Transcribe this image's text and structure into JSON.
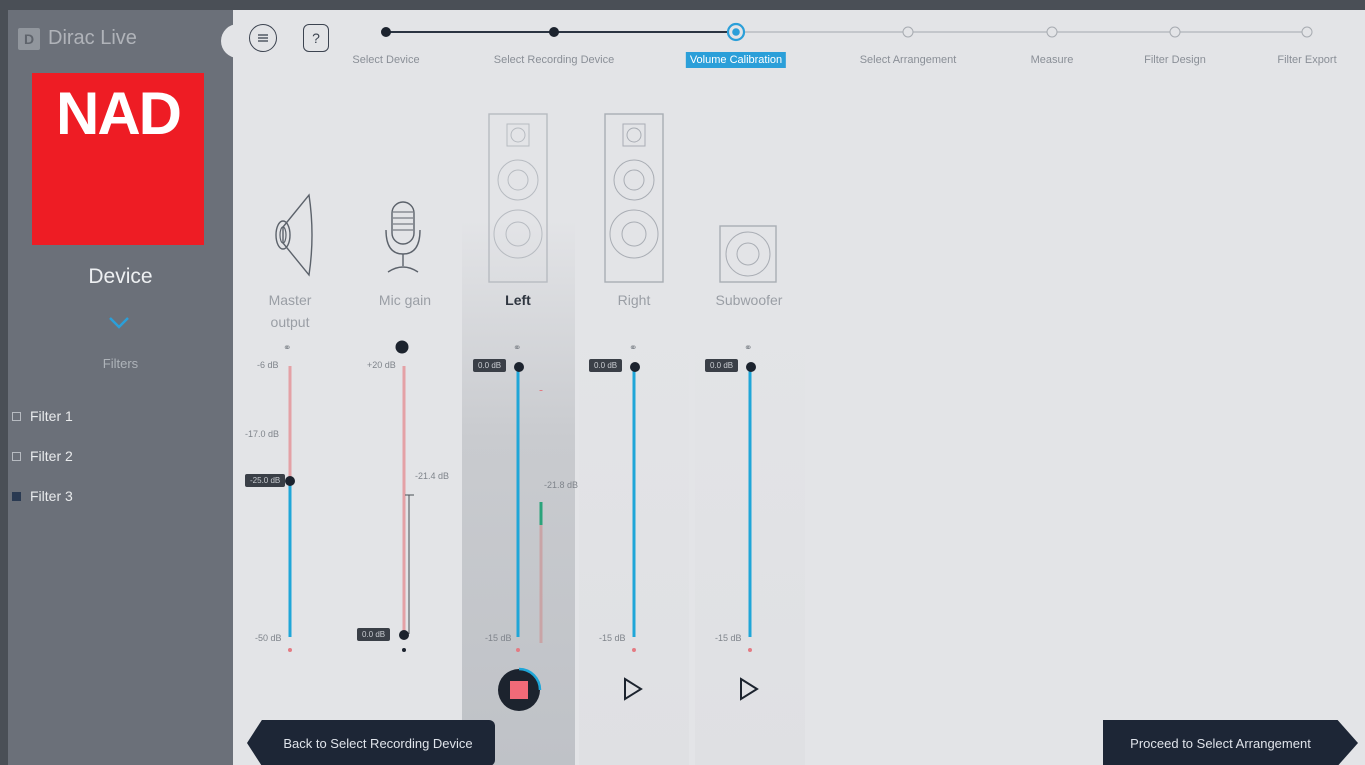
{
  "app": {
    "brand": "Dirac Live"
  },
  "sidebar": {
    "device_logo_text": "NAD",
    "device_label": "Device",
    "filters_heading": "Filters",
    "filters": [
      {
        "label": "Filter 1",
        "selected": false
      },
      {
        "label": "Filter 2",
        "selected": false
      },
      {
        "label": "Filter 3",
        "selected": true
      }
    ]
  },
  "toolbar": {
    "help_label": "?"
  },
  "steps": [
    {
      "label": "Select Device",
      "state": "done"
    },
    {
      "label": "Select Recording Device",
      "state": "done"
    },
    {
      "label": "Volume Calibration",
      "state": "active"
    },
    {
      "label": "Select Arrangement",
      "state": "todo"
    },
    {
      "label": "Measure",
      "state": "todo"
    },
    {
      "label": "Filter Design",
      "state": "todo"
    },
    {
      "label": "Filter Export",
      "state": "todo"
    }
  ],
  "channels": {
    "master": {
      "label_line1": "Master",
      "label_line2": "output",
      "top": "-6 dB",
      "mid": "-17.0 dB",
      "value": "-25.0 dB",
      "bottom": "-50 dB"
    },
    "mic": {
      "label": "Mic gain",
      "top": "+20 dB",
      "peak": "-21.4 dB",
      "value": "0.0 dB"
    },
    "left": {
      "label": "Left",
      "value": "0.0 dB",
      "level": "-21.8 dB",
      "bottom": "-15 dB"
    },
    "right": {
      "label": "Right",
      "value": "0.0 dB",
      "bottom": "-15 dB"
    },
    "sub": {
      "label": "Subwoofer",
      "value": "0.0 dB",
      "bottom": "-15 dB"
    }
  },
  "colors": {
    "accent": "#2b9fd9",
    "slider": "#1fa6d8",
    "stop": "#f06a78",
    "footer": "#1d2636"
  },
  "footer": {
    "back_label": "Back to Select Recording Device",
    "next_label": "Proceed to Select Arrangement"
  }
}
